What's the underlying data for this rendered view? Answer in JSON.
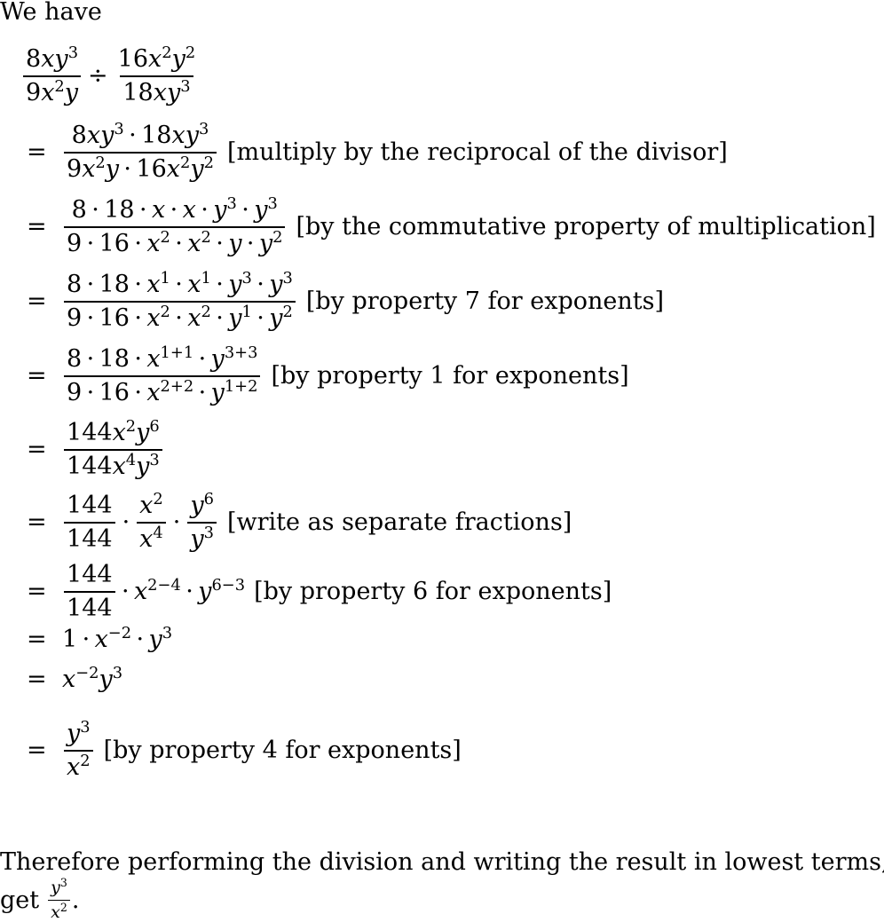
{
  "intro": "We have",
  "steps": [
    {
      "prefix": "",
      "terms": [
        {
          "type": "frac",
          "num": "8xy^3",
          "den": "9x^2y"
        },
        {
          "type": "op",
          "text": "÷"
        },
        {
          "type": "frac",
          "num": "16x^2y^2",
          "den": "18xy^3"
        }
      ],
      "note": ""
    },
    {
      "prefix": "=",
      "terms": [
        {
          "type": "frac",
          "num": "8xy^3 · 18xy^3",
          "den": "9x^2y · 16x^2y^2"
        }
      ],
      "note": "[multiply by the reciprocal of the divisor]"
    },
    {
      "prefix": "=",
      "terms": [
        {
          "type": "frac",
          "num": "8 · 18 · x · x · y^3 · y^3",
          "den": "9 · 16 · x^2 · x^2 · y · y^2"
        }
      ],
      "note": "[by the commutative property of multiplication]"
    },
    {
      "prefix": "=",
      "terms": [
        {
          "type": "frac",
          "num": "8 · 18 · x^1 · x^1 · y^3 · y^3",
          "den": "9 · 16 · x^2 · x^2 · y^1 · y^2"
        }
      ],
      "note": "[by property 7 for exponents]"
    },
    {
      "prefix": "=",
      "terms": [
        {
          "type": "frac",
          "num": "8 · 18 · x^{1+1} · y^{3+3}",
          "den": "9 · 16 · x^{2+2} · y^{1+2}"
        }
      ],
      "note": "[by property 1 for exponents]"
    },
    {
      "prefix": "=",
      "terms": [
        {
          "type": "frac",
          "num": "144x^2y^6",
          "den": "144x^4y^3"
        }
      ],
      "note": ""
    },
    {
      "prefix": "=",
      "terms": [
        {
          "type": "frac",
          "num": "144",
          "den": "144"
        },
        {
          "type": "op",
          "text": "·"
        },
        {
          "type": "frac",
          "num": "x^2",
          "den": "x^4"
        },
        {
          "type": "op",
          "text": "·"
        },
        {
          "type": "frac",
          "num": "y^6",
          "den": "y^3"
        }
      ],
      "note": "[write as separate fractions]"
    },
    {
      "prefix": "=",
      "terms": [
        {
          "type": "frac",
          "num": "144",
          "den": "144"
        },
        {
          "type": "expr",
          "text": "· x^{2−4} · y^{6−3}"
        }
      ],
      "note": "[by property 6 for exponents]"
    },
    {
      "prefix": "=",
      "terms": [
        {
          "type": "expr",
          "text": "1 · x^{−2} · y^3"
        }
      ],
      "note": ""
    },
    {
      "prefix": "=",
      "terms": [
        {
          "type": "expr",
          "text": "x^{−2}y^3"
        }
      ],
      "note": ""
    },
    {
      "prefix": "=",
      "terms": [
        {
          "type": "frac",
          "num": "y^3",
          "den": "x^2"
        }
      ],
      "note": "[by property 4 for exponents]"
    }
  ],
  "conclusion": {
    "line1": "Therefore performing the division and writing the result in lowest terms, we",
    "line2_prefix": "get",
    "result": {
      "num": "y^3",
      "den": "x^2"
    },
    "line2_suffix": "."
  }
}
